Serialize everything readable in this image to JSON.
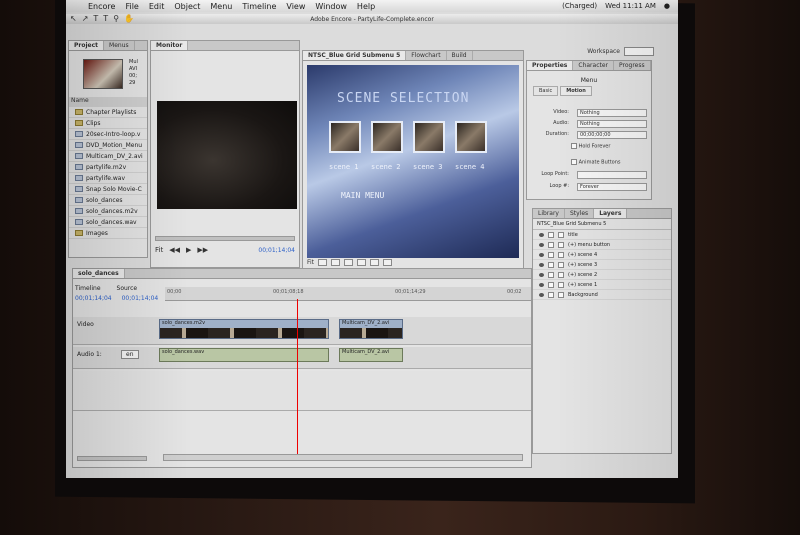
{
  "menubar": {
    "app": "Encore",
    "items": [
      "File",
      "Edit",
      "Object",
      "Menu",
      "Timeline",
      "View",
      "Window",
      "Help"
    ],
    "battery": "(Charged)",
    "clock": "Wed 11:11 AM"
  },
  "window_title": "Adobe Encore - PartyLife-Complete.encor",
  "workspace_label": "Workspace",
  "project_panel": {
    "tabs": [
      "Project",
      "Menus"
    ],
    "meta": [
      "Mul",
      "AVI",
      "00;",
      "29"
    ],
    "column_header": "Name",
    "items": [
      {
        "name": "Chapter Playlists",
        "type": "folder"
      },
      {
        "name": "Clips",
        "type": "folder"
      },
      {
        "name": "20sec-Intro-loop.v",
        "type": "file"
      },
      {
        "name": "DVD_Motion_Menu",
        "type": "file"
      },
      {
        "name": "Multicam_DV_2.avi",
        "type": "file"
      },
      {
        "name": "partylife.m2v",
        "type": "file"
      },
      {
        "name": "partylife.wav",
        "type": "file"
      },
      {
        "name": "Snap Solo Movie-C",
        "type": "file"
      },
      {
        "name": "solo_dances",
        "type": "file"
      },
      {
        "name": "solo_dances.m2v",
        "type": "file"
      },
      {
        "name": "solo_dances.wav",
        "type": "file"
      },
      {
        "name": "Images",
        "type": "folder"
      }
    ]
  },
  "monitor_panel": {
    "tab": "Monitor",
    "fit": "Fit",
    "timecode": "00;01;14;04"
  },
  "menu_editor": {
    "tabs": [
      "NTSC_Blue Grid Submenu 5",
      "Flowchart",
      "Build"
    ],
    "title": "SCENE SELECTION",
    "scenes": [
      "scene 1",
      "scene 2",
      "scene 3",
      "scene 4"
    ],
    "main_menu": "MAIN MENU",
    "fit": "Fit"
  },
  "properties_panel": {
    "tabs": [
      "Properties",
      "Character",
      "Progress"
    ],
    "section": "Menu",
    "subtabs": [
      "Basic",
      "Motion"
    ],
    "fields": [
      {
        "label": "Video:",
        "value": "Nothing"
      },
      {
        "label": "Audio:",
        "value": "Nothing"
      },
      {
        "label": "Duration:",
        "value": "00;00;00;00"
      }
    ],
    "hold_forever": "Hold Forever",
    "animate_buttons": "Animate Buttons",
    "loop_point_label": "Loop Point:",
    "loop_label": "Loop #:",
    "loop_value": "Forever"
  },
  "layers_panel": {
    "tabs": [
      "Library",
      "Styles",
      "Layers"
    ],
    "menu_name": "NTSC_Blue Grid Submenu 5",
    "layers": [
      "title",
      "(+) menu button",
      "(+) scene 4",
      "(+) scene 3",
      "(+) scene 2",
      "(+) scene 1",
      "Background"
    ]
  },
  "timeline_panel": {
    "tab": "solo_dances",
    "timeline_label": "Timeline",
    "source_label": "Source",
    "timeline_tc": "00;01;14;04",
    "source_tc": "00;01;14;04",
    "ruler": [
      "00;00",
      "00;01;08;18",
      "00;01;14;29",
      "00;02"
    ],
    "video_label": "Video",
    "audio_label": "Audio 1:",
    "audio_lang": "en",
    "video_clips": [
      "solo_dances.m2v",
      "Multicam_DV_2.avi"
    ],
    "audio_clips": [
      "solo_dances.wav",
      "Multicam_DV_2.avi"
    ]
  }
}
